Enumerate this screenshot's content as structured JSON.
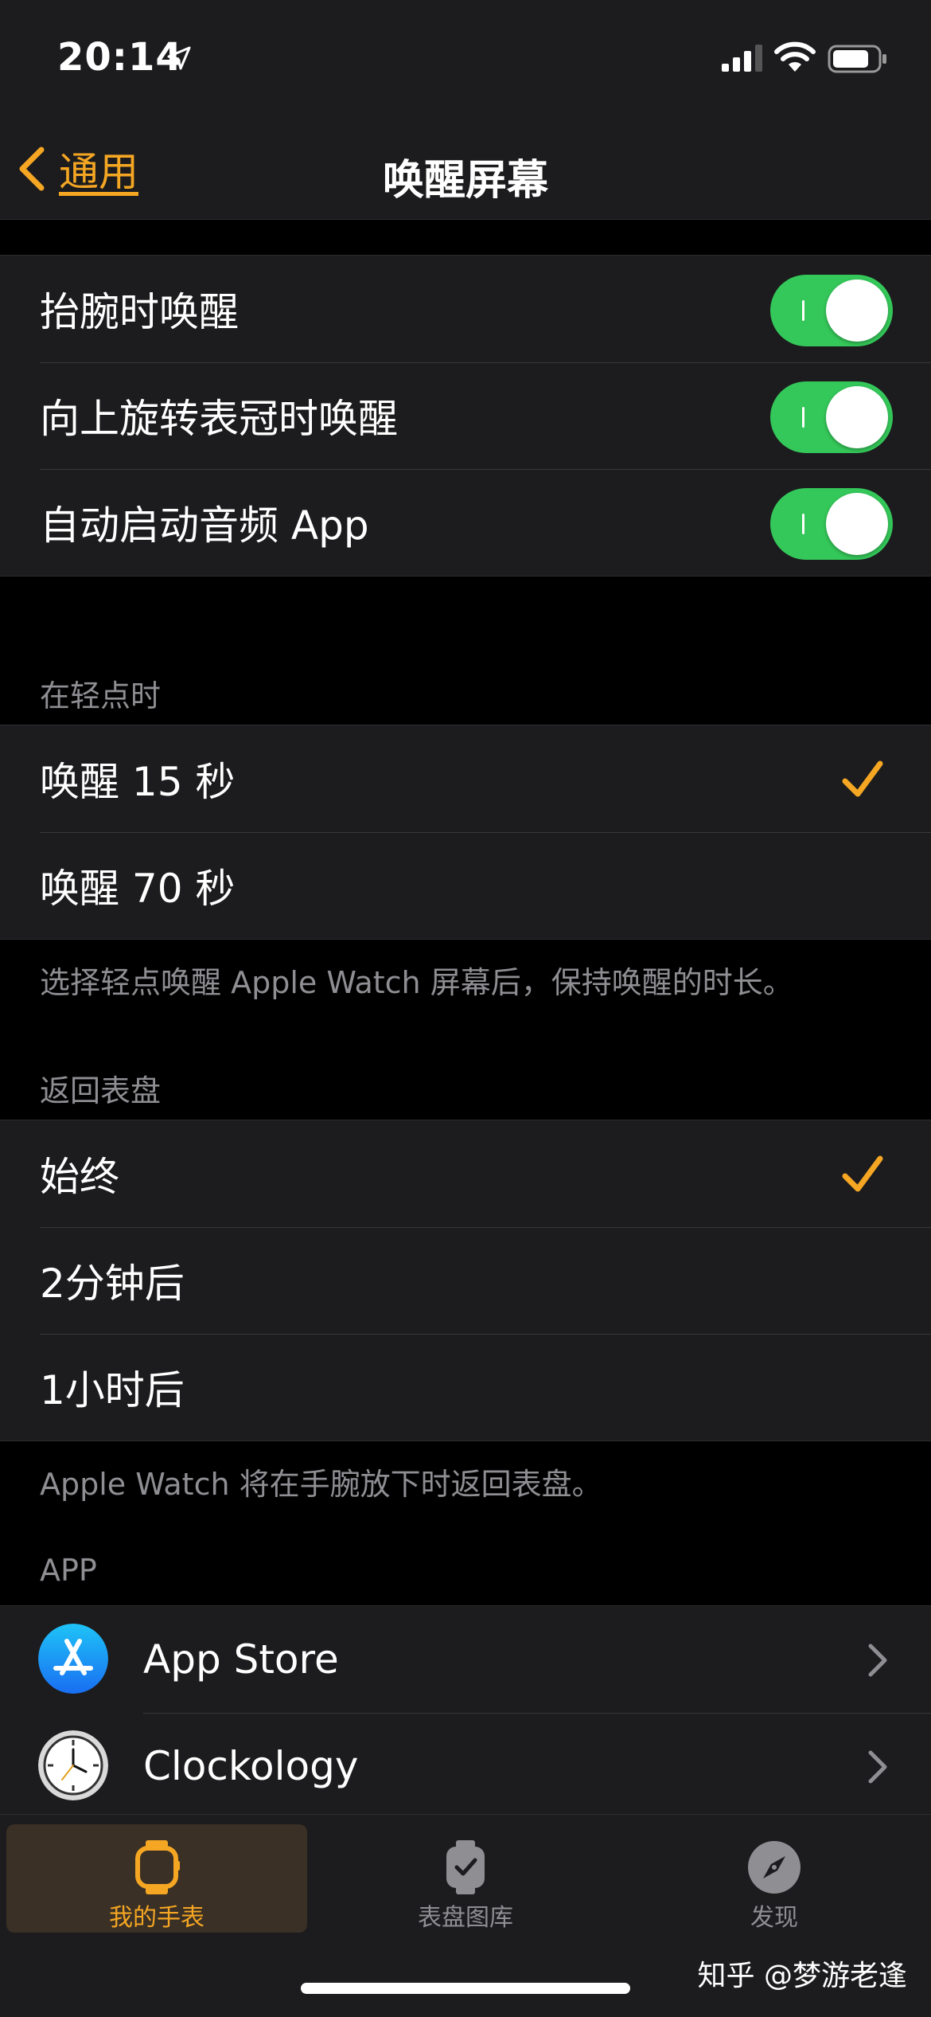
{
  "status_bar": {
    "time": "20:14"
  },
  "nav": {
    "back_label": "通用",
    "title": "唤醒屏幕"
  },
  "wake_toggles": [
    {
      "label": "抬腕时唤醒",
      "on": true
    },
    {
      "label": "向上旋转表冠时唤醒",
      "on": true
    },
    {
      "label": "自动启动音频 App",
      "on": true
    }
  ],
  "tap_section": {
    "header": "在轻点时",
    "options": [
      {
        "label": "唤醒 15 秒",
        "selected": true
      },
      {
        "label": "唤醒 70 秒",
        "selected": false
      }
    ],
    "footer": "选择轻点唤醒 Apple Watch 屏幕后，保持唤醒的时长。"
  },
  "return_section": {
    "header": "返回表盘",
    "options": [
      {
        "label": "始终",
        "selected": true
      },
      {
        "label": "2分钟后",
        "selected": false
      },
      {
        "label": "1小时后",
        "selected": false
      }
    ],
    "footer": "Apple Watch 将在手腕放下时返回表盘。"
  },
  "app_section": {
    "header": "APP",
    "apps": [
      {
        "label": "App Store",
        "icon": "app-store-icon"
      },
      {
        "label": "Clockology",
        "icon": "clock-icon"
      }
    ]
  },
  "tab_bar": {
    "tabs": [
      {
        "label": "我的手表",
        "icon": "watch-icon",
        "active": true
      },
      {
        "label": "表盘图库",
        "icon": "watch-face-gallery-icon",
        "active": false
      },
      {
        "label": "发现",
        "icon": "compass-icon",
        "active": false
      }
    ]
  },
  "watermark": "知乎 @梦游老逢",
  "colors": {
    "accent": "#f5a623",
    "toggle_on": "#34c759",
    "background": "#000000",
    "cell": "#1c1c1e",
    "secondary_text": "#8e8e93"
  }
}
